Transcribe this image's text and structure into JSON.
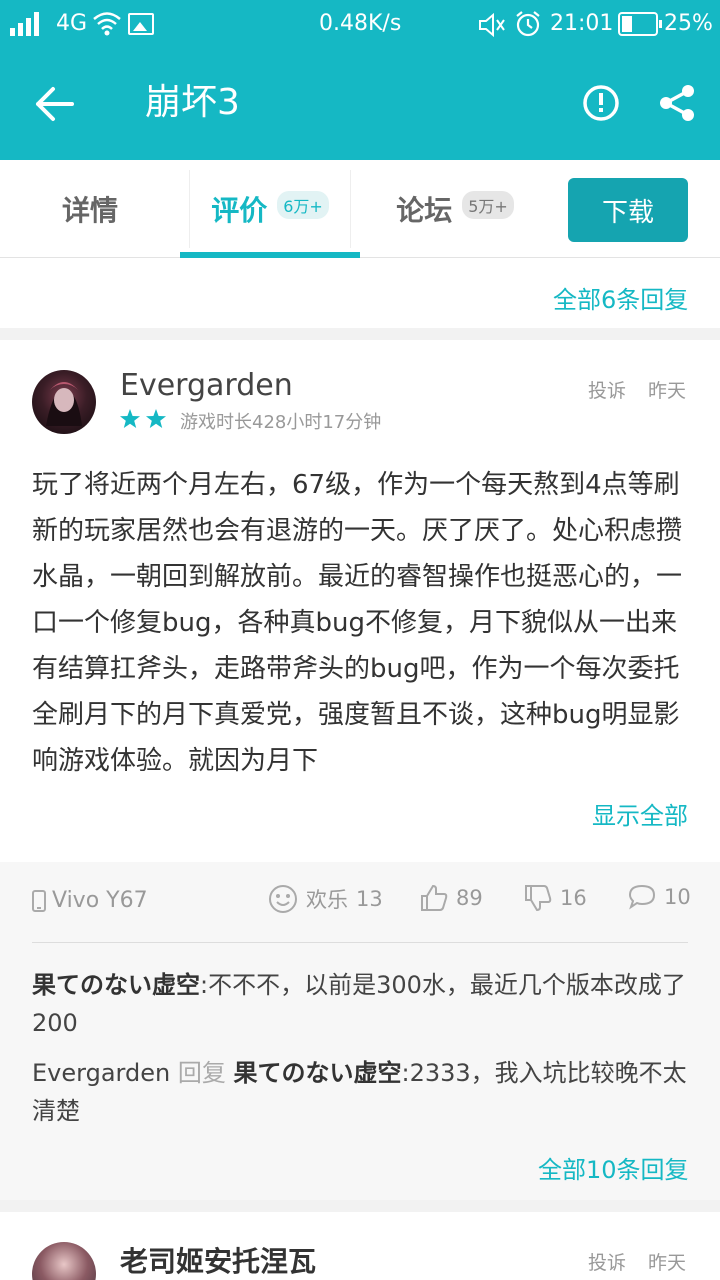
{
  "status": {
    "network": "4G",
    "speed": "0.48K/s",
    "time": "21:01",
    "battery": "25%"
  },
  "appbar": {
    "title": "崩坏3",
    "back_icon": "arrow-left-icon",
    "report_icon": "alert-circle-icon",
    "share_icon": "share-icon"
  },
  "tabs": [
    {
      "label": "详情",
      "badge": ""
    },
    {
      "label": "评价",
      "badge": "6万+"
    },
    {
      "label": "论坛",
      "badge": "5万+"
    }
  ],
  "download_label": "下载",
  "prev_card": {
    "more_replies": "全部6条回复"
  },
  "review": {
    "username": "Evergarden",
    "report": "投诉",
    "date": "昨天",
    "stars": 2,
    "playtime": "游戏时长428小时17分钟",
    "body": "玩了将近两个月左右，67级，作为一个每天熬到4点等刷新的玩家居然也会有退游的一天。厌了厌了。处心积虑攒水晶，一朝回到解放前。最近的睿智操作也挺恶心的，一口一个修复bug，各种真bug不修复，月下貌似从一出来有结算扛斧头，走路带斧头的bug吧，作为一个每次委托全刷月下的月下真爱党，强度暂且不谈，这种bug明显影响游戏体验。就因为月下",
    "show_all": "显示全部",
    "device": "Vivo Y67",
    "reaction_label": "欢乐",
    "reaction_count": "13",
    "likes": "89",
    "dislikes": "16",
    "comments": "10",
    "replies": [
      {
        "author": "果てのない虚空",
        "sep": ":",
        "text": "不不不，以前是300水，最近几个版本改成了200"
      },
      {
        "author": "Evergarden",
        "reply_word": "回复",
        "target": "果てのない虚空",
        "sep": ":",
        "text": "2333，我入坑比较晚不太清楚"
      }
    ],
    "all_replies": "全部10条回复"
  },
  "next_card": {
    "username": "老司姬安托涅瓦",
    "report": "投诉",
    "date": "昨天"
  },
  "colors": {
    "accent": "#15b8c4",
    "download": "#15a4b0"
  }
}
